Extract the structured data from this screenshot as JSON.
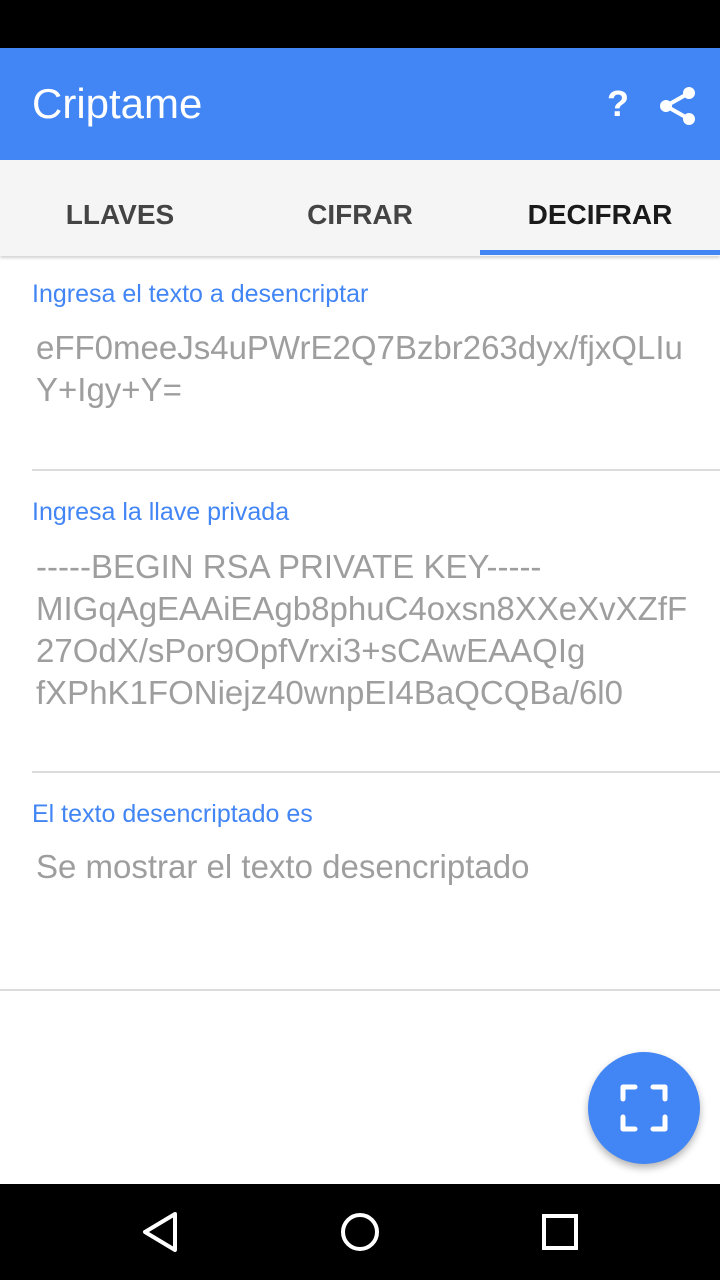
{
  "app": {
    "title": "Criptame"
  },
  "toolbar": {
    "help_label": "?",
    "share_icon": "share-icon"
  },
  "tabs": [
    {
      "label": "LLAVES",
      "active": false
    },
    {
      "label": "CIFRAR",
      "active": false
    },
    {
      "label": "DECIFRAR",
      "active": true
    }
  ],
  "decrypt_form": {
    "ciphertext_label": "Ingresa el texto a desencriptar",
    "ciphertext_value": "eFF0meeJs4uPWrE2Q7Bzbr263dyx/fjxQLIuY+Igy+Y=",
    "private_key_label": "Ingresa la llave privada",
    "private_key_value": "-----BEGIN RSA PRIVATE KEY-----\nMIGqAgEAAiEAgb8phuC4oxsn8XXeXvXZfF27OdX/sPor9OpfVrxi3+sCAwEAAQIg\nfXPhK1FONiejz40wnpEI4BaQCQBa/6l0",
    "result_label": "El texto desencriptado es",
    "result_placeholder": "Se mostrar el texto desencriptado"
  },
  "fab": {
    "icon": "scan-frame-icon"
  },
  "colors": {
    "accent": "#4285f4",
    "status_bar": "#000000",
    "tab_background": "#f5f5f5"
  },
  "nav": {
    "back_icon": "back-icon",
    "home_icon": "home-icon",
    "recents_icon": "recents-icon"
  }
}
